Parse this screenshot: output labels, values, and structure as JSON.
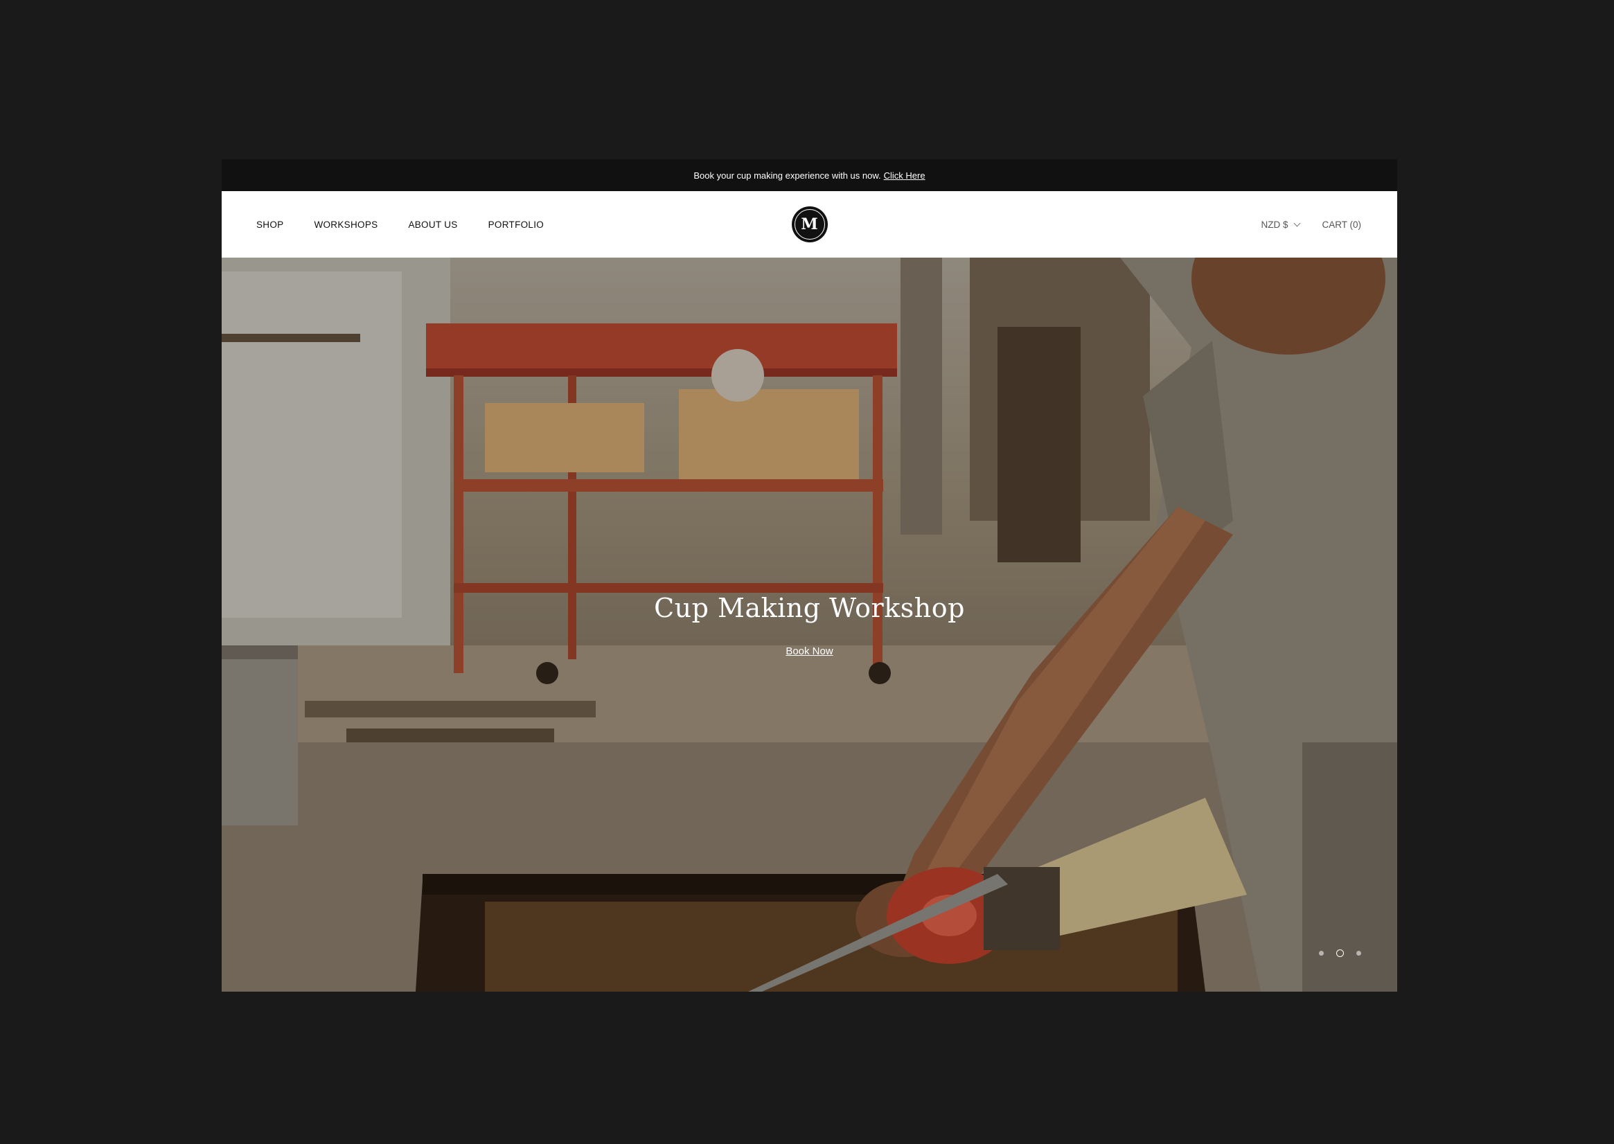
{
  "announcement": {
    "text": "Book your cup making experience with us now.",
    "link_label": "Click Here"
  },
  "nav": {
    "items": [
      {
        "label": "SHOP"
      },
      {
        "label": "WORKSHOPS"
      },
      {
        "label": "ABOUT US"
      },
      {
        "label": "PORTFOLIO"
      }
    ],
    "logo_letter": "M",
    "currency": "NZD $",
    "cart": "CART (0)"
  },
  "hero": {
    "title": "Cup Making Workshop",
    "cta_label": "Book Now",
    "slide_count": 3,
    "active_slide": 2
  },
  "colors": {
    "background": "#1a1a1a",
    "header_bg": "#ffffff",
    "text_dark": "#111111"
  }
}
